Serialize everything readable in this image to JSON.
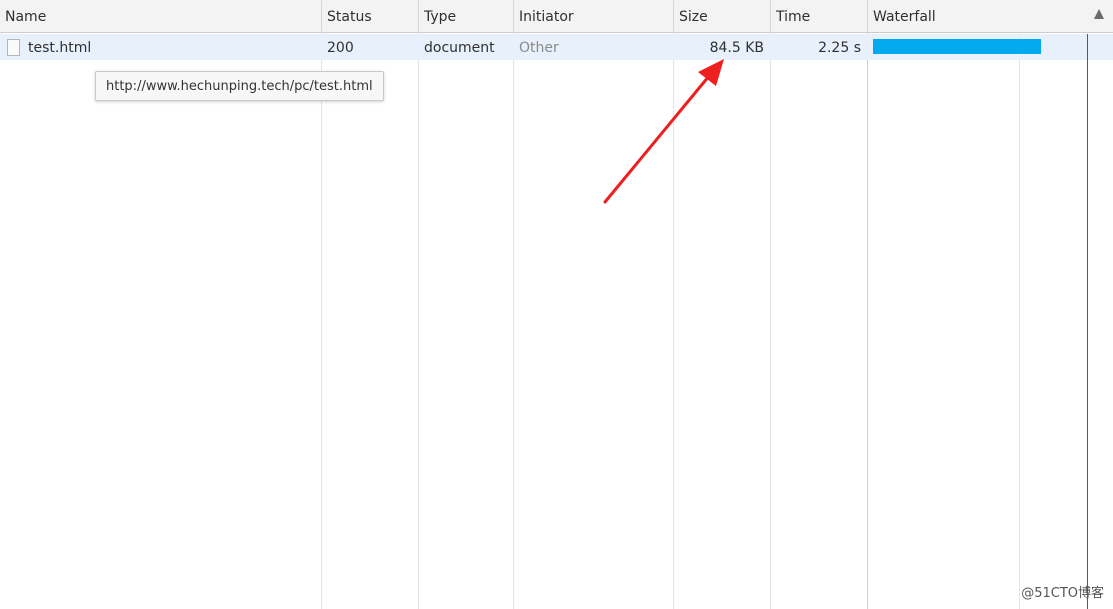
{
  "columns": {
    "name": "Name",
    "status": "Status",
    "type": "Type",
    "initiator": "Initiator",
    "size": "Size",
    "time": "Time",
    "waterfall": "Waterfall"
  },
  "rows": [
    {
      "name": "test.html",
      "status": "200",
      "type": "document",
      "initiator": "Other",
      "size": "84.5 KB",
      "time": "2.25 s"
    }
  ],
  "tooltip": "http://www.hechunping.tech/pc/test.html",
  "watermark": "@51CTO博客",
  "icons": {
    "row_icon": "document-file-icon",
    "sort": "sort-ascending-icon",
    "annotation": "red-arrow-annotation"
  },
  "colors": {
    "waterfall_bar": "#04aaf0",
    "load_event_line": "#e02020",
    "selected_row": "#e8f1fb",
    "annotation_arrow": "#ee1f1f"
  }
}
